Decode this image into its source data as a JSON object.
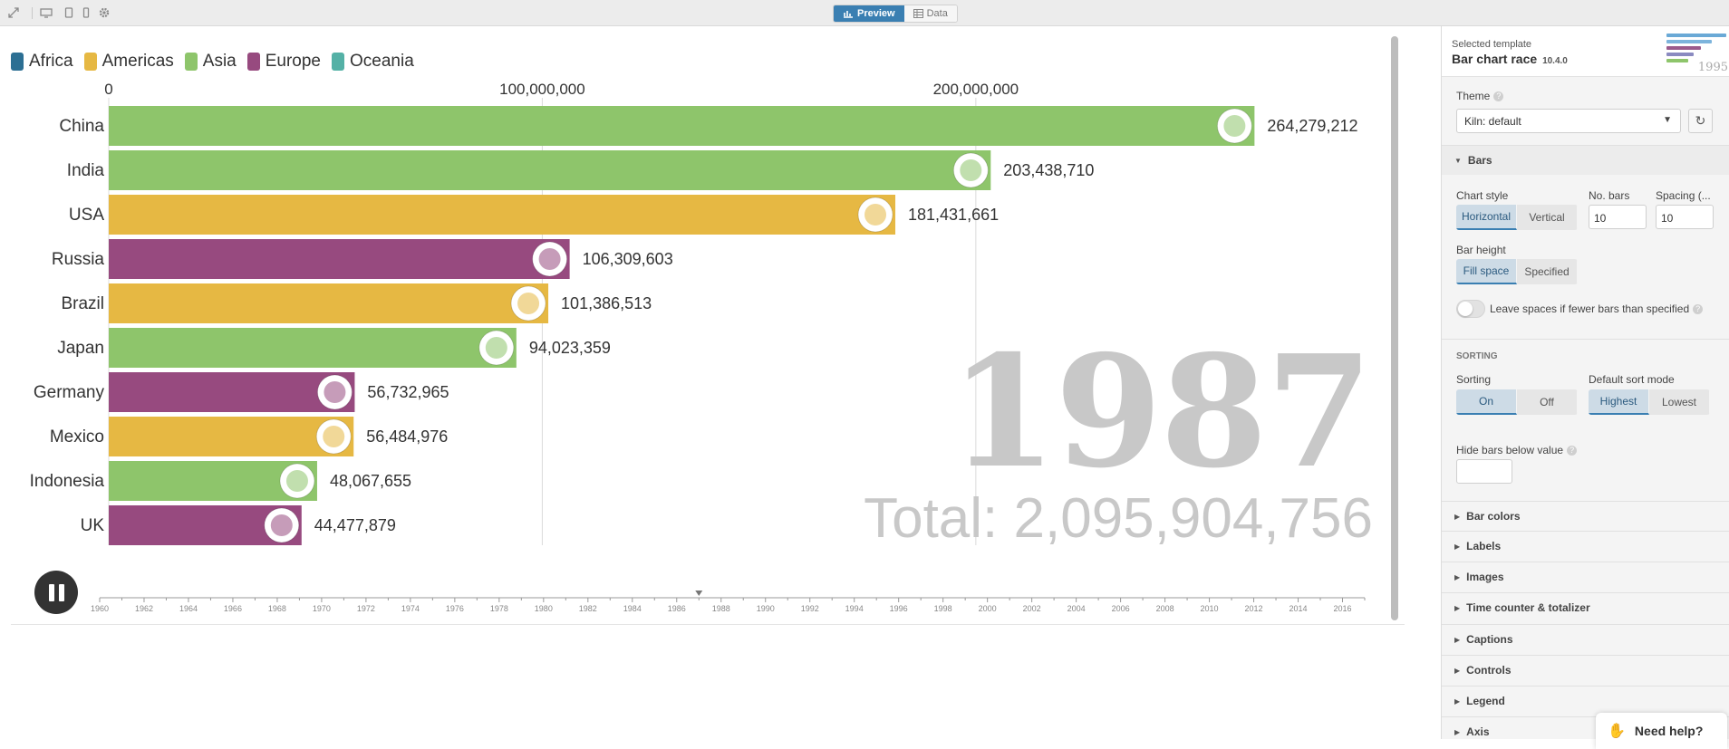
{
  "toolbar": {
    "preview_label": "Preview",
    "data_label": "Data"
  },
  "legend": [
    {
      "name": "Africa",
      "color": "#2c6f93"
    },
    {
      "name": "Americas",
      "color": "#e6b843"
    },
    {
      "name": "Asia",
      "color": "#8ec56b"
    },
    {
      "name": "Europe",
      "color": "#974a7f"
    },
    {
      "name": "Oceania",
      "color": "#54b1a6"
    }
  ],
  "chart_data": {
    "type": "bar",
    "orientation": "horizontal",
    "categories": [
      "China",
      "India",
      "USA",
      "Russia",
      "Brazil",
      "Japan",
      "Germany",
      "Mexico",
      "Indonesia",
      "UK"
    ],
    "values": [
      264279212,
      203438710,
      181431661,
      106309603,
      101386513,
      94023359,
      56732965,
      56484976,
      48067655,
      44477879
    ],
    "value_labels": [
      "264,279,212",
      "203,438,710",
      "181,431,661",
      "106,309,603",
      "101,386,513",
      "94,023,359",
      "56,732,965",
      "56,484,976",
      "48,067,655",
      "44,477,879"
    ],
    "regions": [
      "Asia",
      "Asia",
      "Americas",
      "Europe",
      "Americas",
      "Asia",
      "Europe",
      "Americas",
      "Asia",
      "Europe"
    ],
    "xaxis_ticks": [
      0,
      100000000,
      200000000
    ],
    "xaxis_tick_labels": [
      "0",
      "100,000,000",
      "200,000,000"
    ],
    "xlim": [
      0,
      292000000
    ],
    "axis_position": "top",
    "grid": true,
    "legend_position": "top-left",
    "year": "1987",
    "total_label": "Total: 2,095,904,756",
    "timeline": {
      "start": 1960,
      "end": 2017,
      "current": 1987,
      "tick_labels": [
        "1960",
        "1962",
        "1964",
        "1966",
        "1968",
        "1970",
        "1972",
        "1974",
        "1976",
        "1978",
        "1980",
        "1982",
        "1984",
        "1986",
        "1988",
        "1990",
        "1992",
        "1994",
        "1996",
        "1998",
        "2000",
        "2002",
        "2004",
        "2006",
        "2008",
        "2010",
        "2012",
        "2014",
        "2016"
      ]
    }
  },
  "panel": {
    "selected_template_label": "Selected template",
    "template_name": "Bar chart race",
    "template_version": "10.4.0",
    "thumb_year": "1995",
    "theme_label": "Theme",
    "theme_value": "Kiln: default",
    "bars_section": "Bars",
    "chart_style_label": "Chart style",
    "chart_style_options": [
      "Horizontal",
      "Vertical"
    ],
    "no_bars_label": "No. bars",
    "no_bars_value": "10",
    "spacing_label": "Spacing (...",
    "spacing_value": "10",
    "bar_height_label": "Bar height",
    "bar_height_options": [
      "Fill space",
      "Specified"
    ],
    "leave_spaces_label": "Leave spaces if fewer bars than specified",
    "sorting_heading": "SORTING",
    "sorting_label": "Sorting",
    "sorting_options": [
      "On",
      "Off"
    ],
    "default_sort_label": "Default sort mode",
    "default_sort_options": [
      "Highest",
      "Lowest"
    ],
    "hide_bars_label": "Hide bars below value",
    "sections": [
      "Bar colors",
      "Labels",
      "Images",
      "Time counter & totalizer",
      "Captions",
      "Controls",
      "Legend",
      "Axis"
    ]
  },
  "help": {
    "label": "Need help?"
  }
}
